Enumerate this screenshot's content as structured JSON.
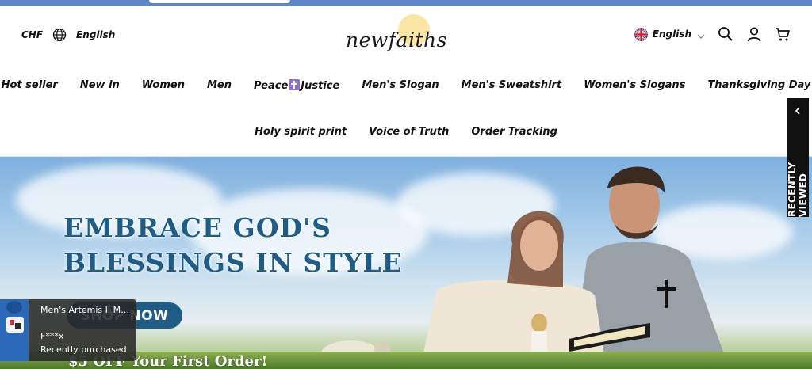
{
  "header": {
    "currency": "CHF",
    "language_left": "English",
    "logo_text": "newfaiths",
    "language_right": "English"
  },
  "nav": {
    "row1": [
      "Hot seller",
      "New in",
      "Women",
      "Men",
      "Peace",
      "Justice",
      "Men's Slogan",
      "Men's Sweatshirt",
      "Women's Slogans",
      "Thanksgiving Day"
    ],
    "row2": [
      "Holy spirit print",
      "Voice of Truth",
      "Order Tracking"
    ]
  },
  "recently_viewed": "RECENTLY VIEWED",
  "hero": {
    "title_line1": "EMBRACE GOD'S",
    "title_line2": "BLESSINGS IN STYLE",
    "cta": "SHOP NOW",
    "promo": "$5 OFF Your First Order!"
  },
  "popup": {
    "product": "Men's Artemis II Mo...",
    "customer": "F***x",
    "status": "Recently purchased"
  },
  "colors": {
    "accent": "#1f5d86",
    "nav_text": "#111111",
    "announce_bar": "#5f86c7"
  }
}
